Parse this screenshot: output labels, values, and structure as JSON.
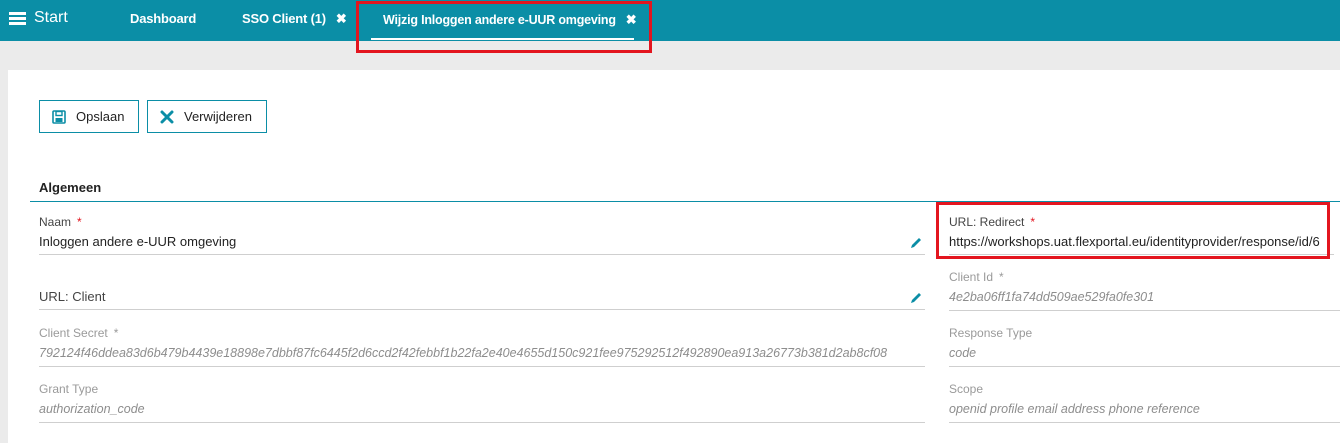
{
  "topbar": {
    "start_label": "Start",
    "tabs": [
      {
        "label": "Dashboard"
      },
      {
        "label": "SSO Client (1)"
      },
      {
        "label": "Wijzig Inloggen andere e-UUR omgeving"
      }
    ]
  },
  "toolbar": {
    "save_label": "Opslaan",
    "delete_label": "Verwijderen"
  },
  "section": {
    "title": "Algemeen"
  },
  "fields": {
    "naam": {
      "label": "Naam",
      "required": "*",
      "value": "Inloggen andere e-UUR omgeving"
    },
    "url_client": {
      "label": "URL: Client",
      "value": ""
    },
    "client_secret": {
      "label": "Client Secret",
      "required": "*",
      "value": "792124f46ddea83d6b479b4439e18898e7dbbf87fc6445f2d6ccd2f42febbf1b22fa2e40e4655d150c921fee975292512f492890ea913a26773b381d2ab8cf08"
    },
    "grant_type": {
      "label": "Grant Type",
      "value": "authorization_code"
    },
    "url_redirect": {
      "label": "URL: Redirect",
      "required": "*",
      "value": "https://workshops.uat.flexportal.eu/identityprovider/response/id/6"
    },
    "client_id": {
      "label": "Client Id",
      "required": "*",
      "value": "4e2ba06ff1fa74dd509ae529fa0fe301"
    },
    "response_type": {
      "label": "Response Type",
      "value": "code"
    },
    "scope": {
      "label": "Scope",
      "value": "openid profile email address phone reference"
    }
  },
  "colors": {
    "topbar": "#0b8ea6",
    "highlight": "#e3151f",
    "required": "#e3151f"
  },
  "icons": [
    "hamburger-icon",
    "close-icon",
    "save-icon",
    "delete-icon",
    "pencil-icon"
  ]
}
